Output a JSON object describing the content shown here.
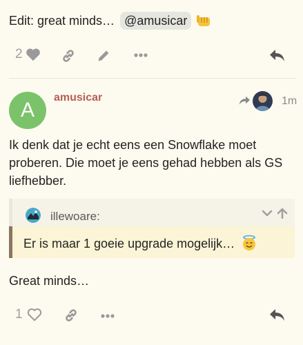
{
  "top_post": {
    "edit_text": "Edit: great minds…",
    "mention": "@amusicar",
    "emoji_icon": "fist-bump-emoji-icon",
    "like_count": "2"
  },
  "reply_post": {
    "username": "amusicar",
    "avatar_letter": "A",
    "avatar_color": "#7ac36a",
    "username_color": "#b55e55",
    "time": "1m",
    "body": "Ik denk dat je echt eens een Snowflake moet proberen. Die moet je eens gehad hebben als GS liefhebber.",
    "quote": {
      "username": "illewoare:",
      "text": "Er is maar 1 goeie upgrade mogelijk…",
      "emoji_icon": "innocent-smile-emoji-icon"
    },
    "footer_text": "Great minds…",
    "like_count": "1"
  },
  "colors": {
    "background": "#fdfbef",
    "icon_gray": "#9a9a9a",
    "quote_bar": "#8a7560",
    "quote_body_bg": "#fbf4d7"
  }
}
